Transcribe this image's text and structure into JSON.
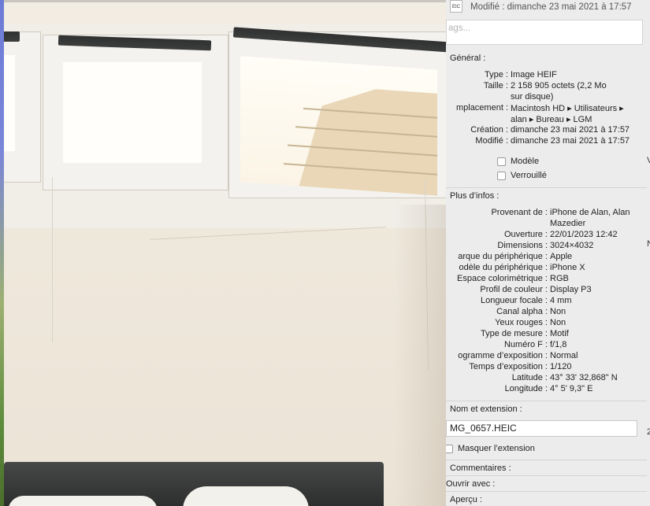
{
  "header": {
    "file_icon_label": "EIC",
    "modified_summary": "Modifié : dimanche 23 mai 2021 à 17:57"
  },
  "tags": {
    "placeholder": "ags..."
  },
  "general": {
    "title": "Général :",
    "rows": [
      {
        "label": "Type :",
        "value": "Image HEIF"
      },
      {
        "label": "Taille :",
        "value": "2 158 905 octets (2,2 Mo",
        "value2": "sur disque)"
      },
      {
        "label": "mplacement :",
        "value": "Macintosh HD ▸ Utilisateurs ▸",
        "value2": "alan ▸ Bureau ▸ LGM"
      },
      {
        "label": "Création :",
        "value": "dimanche 23 mai 2021 à 17:57"
      },
      {
        "label": "Modifié :",
        "value": "dimanche 23 mai 2021 à 17:57"
      }
    ],
    "checkboxes": [
      {
        "label": "Modèle",
        "checked": false
      },
      {
        "label": "Verrouillé",
        "checked": false
      }
    ]
  },
  "more_info": {
    "title": "Plus d’infos :",
    "rows": [
      {
        "label": "Provenant de :",
        "value": "iPhone de Alan, Alan",
        "value2": "Mazedier"
      },
      {
        "label": "Ouverture :",
        "value": "22/01/2023 12:42"
      },
      {
        "label": "Dimensions :",
        "value": "3024×4032"
      },
      {
        "label": "arque du périphérique :",
        "value": "Apple"
      },
      {
        "label": "odèle du périphérique :",
        "value": "iPhone X"
      },
      {
        "label": "Espace colorimétrique :",
        "value": "RGB"
      },
      {
        "label": "Profil de couleur :",
        "value": "Display P3"
      },
      {
        "label": "Longueur focale :",
        "value": "4 mm"
      },
      {
        "label": "Canal alpha :",
        "value": "Non"
      },
      {
        "label": "Yeux rouges :",
        "value": "Non"
      },
      {
        "label": "Type de mesure :",
        "value": "Motif"
      },
      {
        "label": "Numéro F :",
        "value": "f/1,8"
      },
      {
        "label": "ogramme d’exposition :",
        "value": "Normal"
      },
      {
        "label": "Temps d’exposition :",
        "value": "1/120"
      },
      {
        "label": "Latitude :",
        "value": "43° 33' 32,868\" N"
      },
      {
        "label": "Longitude :",
        "value": "4° 5' 9,3\" E"
      }
    ]
  },
  "name_ext": {
    "title": "Nom et extension :",
    "filename": "MG_0657.HEIC",
    "hide_ext_label": "Masquer l’extension"
  },
  "comments": {
    "title": "Commentaires :"
  },
  "open_with": {
    "title": "Ouvrir avec :"
  },
  "preview": {
    "title": "Aperçu :"
  },
  "offscreen_chars": {
    "a": "V",
    "b": "N",
    "c": "2"
  }
}
